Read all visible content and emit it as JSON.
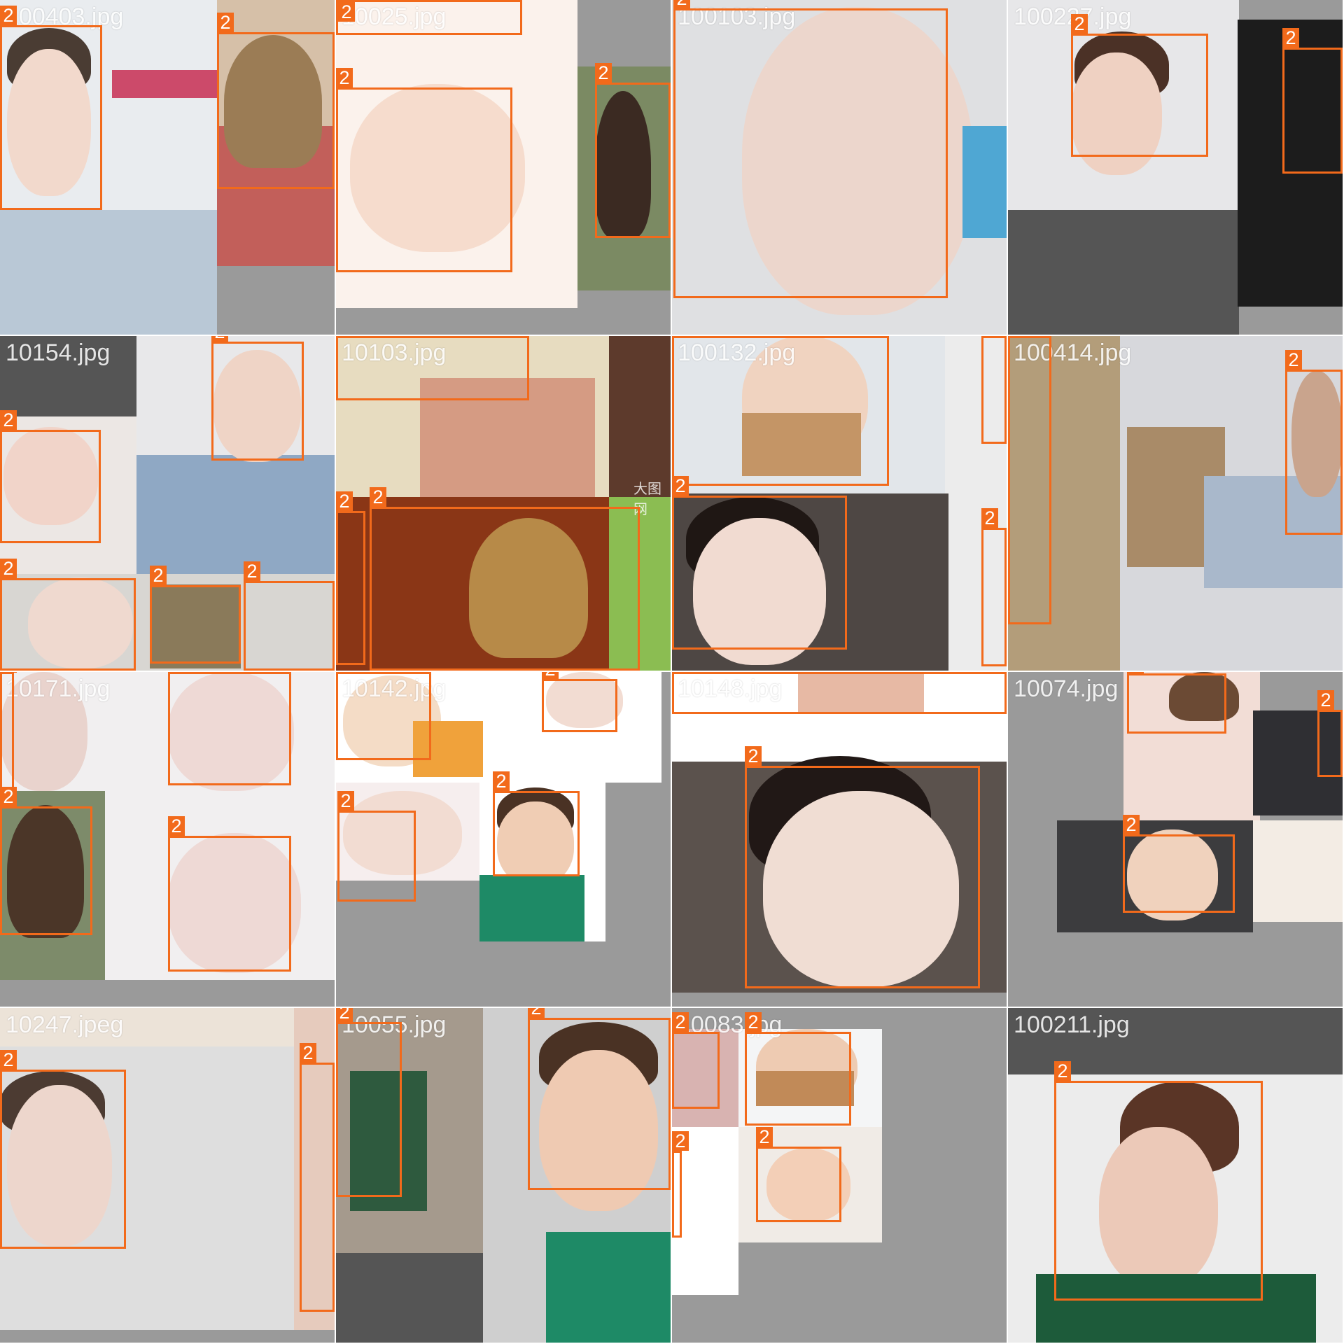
{
  "mosaic": {
    "tiles": [
      {
        "filename": "100403.jpg",
        "boxes": [
          "2",
          "2"
        ]
      },
      {
        "filename": "10025.jpg",
        "boxes": [
          "2",
          "2",
          "2"
        ]
      },
      {
        "filename": "100103.jpg",
        "boxes": [
          "2"
        ]
      },
      {
        "filename": "100227.jpg",
        "boxes": [
          "2",
          "2"
        ]
      },
      {
        "filename": "10154.jpg",
        "boxes": [
          "2",
          "2",
          "2",
          "2",
          "2"
        ]
      },
      {
        "filename": "10103.jpg",
        "boxes": [
          "2",
          "2",
          "2"
        ]
      },
      {
        "filename": "100132.jpg",
        "boxes": [
          "2",
          "2",
          "2",
          "2"
        ]
      },
      {
        "filename": "100414.jpg",
        "boxes": [
          "2",
          "2"
        ]
      },
      {
        "filename": "10171.jpg",
        "boxes": [
          "2",
          "2",
          "2",
          "2"
        ]
      },
      {
        "filename": "10142.jpg",
        "boxes": [
          "2",
          "2",
          "2",
          "2"
        ]
      },
      {
        "filename": "10148.jpg",
        "boxes": [
          "2",
          "2"
        ]
      },
      {
        "filename": "10074.jpg",
        "boxes": [
          "2",
          "2",
          "2"
        ]
      },
      {
        "filename": "10247.jpeg",
        "boxes": [
          "2",
          "2"
        ]
      },
      {
        "filename": "10055.jpg",
        "boxes": [
          "2",
          "2"
        ]
      },
      {
        "filename": "10083.jpg",
        "boxes": [
          "2",
          "2",
          "2",
          "2"
        ]
      },
      {
        "filename": "100211.jpg",
        "boxes": [
          "2"
        ]
      }
    ],
    "watermarks": [
      "大图网"
    ]
  },
  "colors": {
    "box": "#f26a1b",
    "label_text": "#ffffff",
    "pad": "#9a9a9a"
  }
}
